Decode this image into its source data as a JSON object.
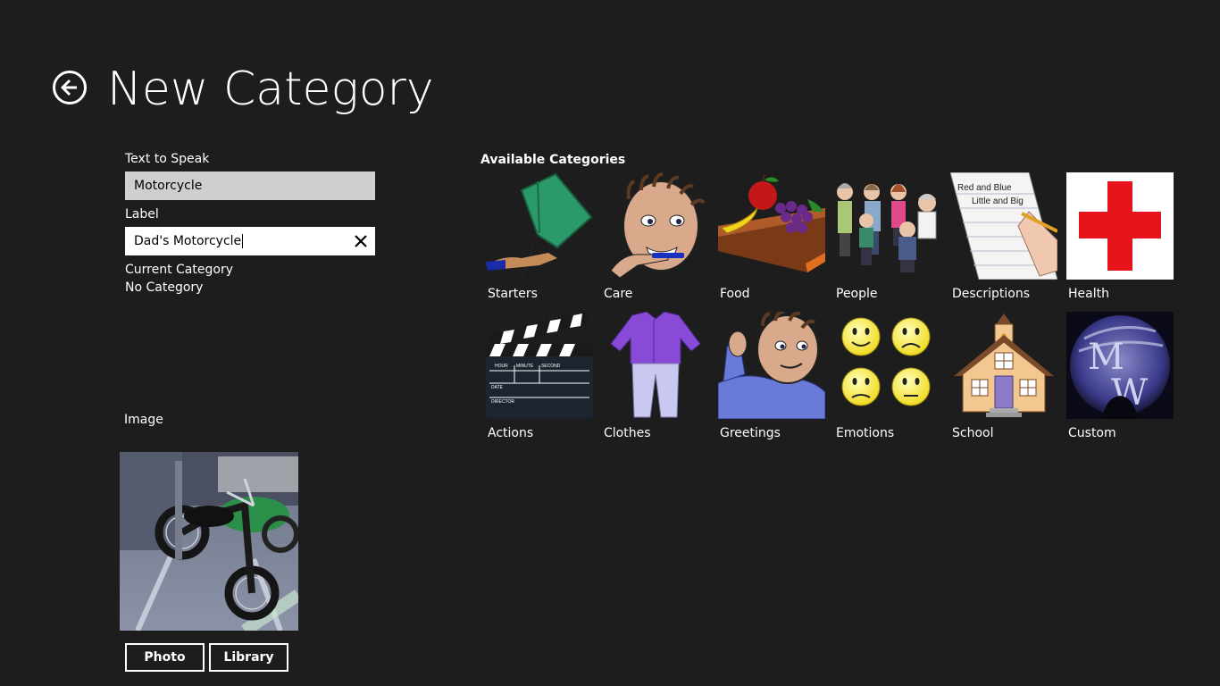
{
  "header": {
    "title": "New Category"
  },
  "form": {
    "text_to_speak_label": "Text to Speak",
    "text_to_speak_value": "Motorcycle",
    "label_label": "Label",
    "label_value": "Dad's Motorcycle",
    "current_category_label": "Current Category",
    "current_category_value": "No Category",
    "image_label": "Image"
  },
  "buttons": {
    "photo": "Photo",
    "library": "Library"
  },
  "categories": {
    "title": "Available Categories",
    "items": [
      {
        "label": "Starters",
        "icon": "flag-icon"
      },
      {
        "label": "Care",
        "icon": "toothbrush-boy-icon"
      },
      {
        "label": "Food",
        "icon": "food-icon"
      },
      {
        "label": "People",
        "icon": "people-icon"
      },
      {
        "label": "Descriptions",
        "icon": "writing-icon"
      },
      {
        "label": "Health",
        "icon": "red-cross-icon"
      },
      {
        "label": "Actions",
        "icon": "clapperboard-icon"
      },
      {
        "label": "Clothes",
        "icon": "clothes-icon"
      },
      {
        "label": "Greetings",
        "icon": "waving-boy-icon"
      },
      {
        "label": "Emotions",
        "icon": "smileys-icon"
      },
      {
        "label": "School",
        "icon": "schoolhouse-icon"
      },
      {
        "label": "Custom",
        "icon": "mw-logo-icon"
      }
    ],
    "descriptions_text_line1": "Red and Blue",
    "descriptions_text_line2": "Little and Big",
    "clapper_fields": [
      "HOUR",
      "MINUTE",
      "SECOND",
      "DATE",
      "DIRECTOR"
    ],
    "custom_logo_letters": [
      "M",
      "W"
    ]
  },
  "colors": {
    "background": "#1d1d1d",
    "readonly_input": "#cfcfcf",
    "red_cross": "#e8141c"
  }
}
